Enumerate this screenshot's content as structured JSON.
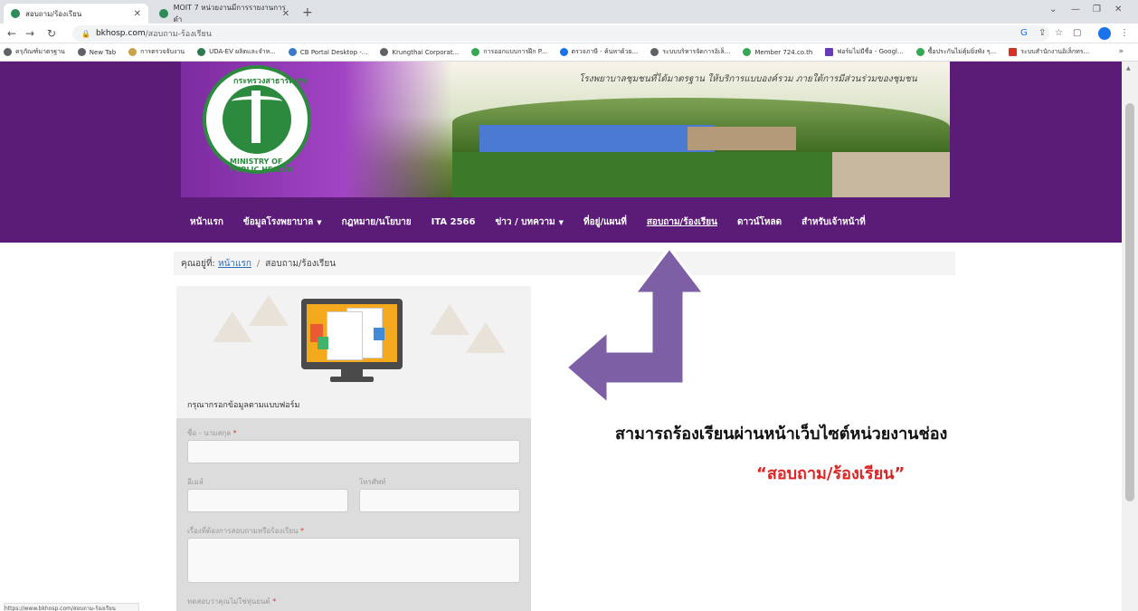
{
  "browser": {
    "tabs": [
      {
        "title": "สอบถาม/ร้องเรียน"
      },
      {
        "title": "MOIT 7 หน่วยงานมีการรายงานการดำ"
      }
    ],
    "url_host": "bkhosp.com",
    "url_path": "/สอบถาม-ร้องเรียน",
    "bookmarks": [
      "ครุภัณฑ์มาตรฐาน",
      "New Tab",
      "การตรวจจับงาน",
      "UDA-EV ผลิตและจำห...",
      "CB Portal Desktop -...",
      "Krungthai Corporat...",
      "การออกแบบการฝึก P...",
      "ตรวจภาษี - ค้นหาด้วย...",
      "ระบบบริหารจัดการอิเล็...",
      "Member 724.co.th",
      "ฟอร์มไม่มีชื่อ - Googl...",
      "ซื้อประกันไม่คุ้มยิ่งพัง ๆ...",
      "ระบบสำนักงานอิเล็กทร..."
    ]
  },
  "banner": {
    "slogan": "โรงพยาบาลชุมชนที่ได้มาตรฐาน ให้บริการแบบองค์รวม ภายใต้การมีส่วนร่วมของชุมชน",
    "seal_thai": "กระทรวงสาธารณสุข",
    "seal_en": "MINISTRY OF PUBLIC HEALTH"
  },
  "menu": [
    {
      "label": "หน้าแรก",
      "dropdown": false
    },
    {
      "label": "ข้อมูลโรงพยาบาล",
      "dropdown": true
    },
    {
      "label": "กฎหมาย/นโยบาย",
      "dropdown": false
    },
    {
      "label": "ITA 2566",
      "dropdown": false
    },
    {
      "label": "ข่าว / บทความ",
      "dropdown": true
    },
    {
      "label": "ที่อยู่/แผนที่",
      "dropdown": false
    },
    {
      "label": "สอบถาม/ร้องเรียน",
      "dropdown": false
    },
    {
      "label": "ดาวน์โหลด",
      "dropdown": false
    },
    {
      "label": "สำหรับเจ้าหน้าที่",
      "dropdown": false
    }
  ],
  "breadcrumb": {
    "prefix": "คุณอยู่ที่:",
    "home": "หน้าแรก",
    "current": "สอบถาม/ร้องเรียน"
  },
  "form": {
    "caption": "กรุณากรอกข้อมูลตามแบบฟอร์ม",
    "name_label": "ชื่อ - นามสกุล",
    "email_label": "อีเมล์",
    "phone_label": "โทรศัพท์",
    "topic_label": "เรื่องที่ต้องการสอบถามหรือร้องเรียน",
    "captcha_label": "ทดสอบว่าคุณไม่ใช่หุ่นยนต์",
    "required_mark": "*"
  },
  "status_bar": "https://www.bkhosp.com/สอบถาม-ร้องเรียน",
  "annotation": {
    "line1": "สามารถร้องเรียนผ่านหน้าเว็บไซต์หน่วยงานช่อง",
    "line2": "“สอบถาม/ร้องเรียน”",
    "arrow_color": "#7d5fa6",
    "highlight_color": "#e02424"
  }
}
